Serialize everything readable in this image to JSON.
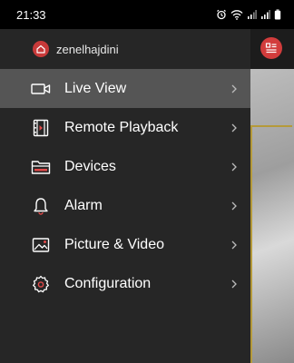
{
  "status_bar": {
    "time": "21:33",
    "icons": [
      "alarm-clock-icon",
      "wifi-icon",
      "signal-1-icon",
      "signal-2-icon",
      "battery-icon"
    ]
  },
  "drawer": {
    "username": "zenelhajdini",
    "accent_color": "#c83a3a",
    "items": [
      {
        "label": "Live View",
        "icon": "camera-icon",
        "active": true
      },
      {
        "label": "Remote Playback",
        "icon": "film-icon",
        "active": false
      },
      {
        "label": "Devices",
        "icon": "dvr-device-icon",
        "active": false
      },
      {
        "label": "Alarm",
        "icon": "bell-icon",
        "active": false
      },
      {
        "label": "Picture & Video",
        "icon": "picture-icon",
        "active": false
      },
      {
        "label": "Configuration",
        "icon": "gear-icon",
        "active": false
      }
    ]
  }
}
